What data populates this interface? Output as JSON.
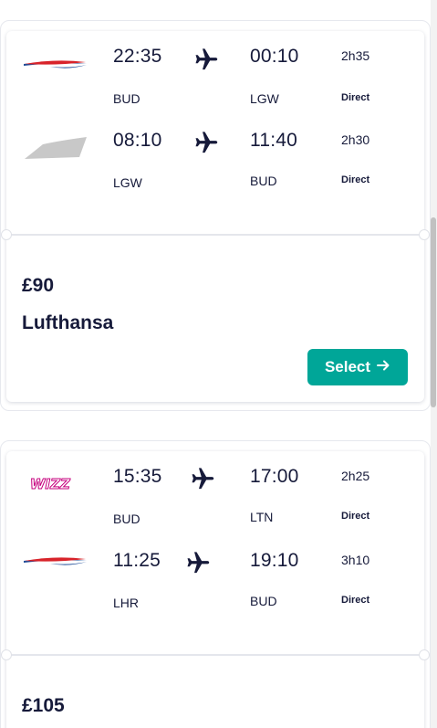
{
  "results": [
    {
      "legs": [
        {
          "airline_logo": "british-airways-logo",
          "dep_time": "22:35",
          "arr_time": "00:10",
          "dep_code": "BUD",
          "arr_code": "LGW",
          "duration": "2h35",
          "stops": "Direct"
        },
        {
          "airline_logo": "generic-airline-logo",
          "dep_time": "08:10",
          "arr_time": "11:40",
          "dep_code": "LGW",
          "arr_code": "BUD",
          "duration": "2h30",
          "stops": "Direct"
        }
      ],
      "price": "£90",
      "airline": "Lufthansa",
      "select_label": "Select"
    },
    {
      "legs": [
        {
          "airline_logo": "wizz-air-logo",
          "dep_time": "15:35",
          "arr_time": "17:00",
          "dep_code": "BUD",
          "arr_code": "LTN",
          "duration": "2h25",
          "stops": "Direct"
        },
        {
          "airline_logo": "british-airways-logo",
          "dep_time": "11:25",
          "arr_time": "19:10",
          "dep_code": "LHR",
          "arr_code": "BUD",
          "duration": "3h10",
          "stops": "Direct"
        }
      ],
      "price": "£105"
    }
  ],
  "icons": {
    "plane": "plane-icon",
    "arrow": "arrow-right-icon"
  },
  "colors": {
    "accent": "#00a698",
    "text": "#161a3a",
    "ba_red": "#d8232a",
    "ba_blue": "#1c4a97",
    "wizz_pink": "#c6007e"
  }
}
